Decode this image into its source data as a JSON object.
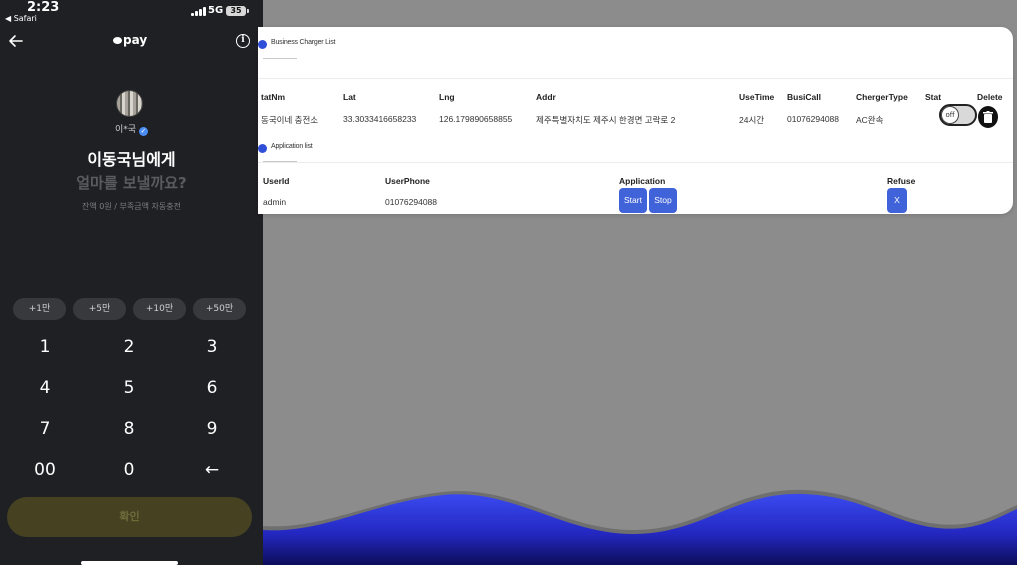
{
  "phone": {
    "status": {
      "time": "2:23",
      "back_app": "◀ Safari",
      "network": "5G",
      "battery": "35"
    },
    "header": {
      "logo_text": "pay"
    },
    "recipient": {
      "masked_name": "이*국",
      "to_line": "이동국님에게",
      "prompt": "얼마를 보낼까요?",
      "balance": "잔액 0원 / 부족금액 자동충전"
    },
    "quick_amounts": [
      "+1만",
      "+5만",
      "+10만",
      "+50만"
    ],
    "keypad": [
      "1",
      "2",
      "3",
      "4",
      "5",
      "6",
      "7",
      "8",
      "9",
      "00",
      "0",
      "←"
    ],
    "confirm_label": "확인"
  },
  "admin": {
    "charger_section": {
      "title": "Business Charger List",
      "columns": [
        "tatNm",
        "Lat",
        "Lng",
        "Addr",
        "UseTime",
        "BusiCall",
        "ChergerType",
        "Stat",
        "Delete"
      ],
      "rows": [
        {
          "statNm": "동국이네 충전소",
          "lat": "33.3033416658233",
          "lng": "126.179890658855",
          "addr": "제주특별자치도 제주시 한경면 고락로 2",
          "use_time": "24시간",
          "busi_call": "01076294088",
          "charger_type": "AC완속",
          "stat": "off"
        }
      ]
    },
    "application_section": {
      "title": "Application list",
      "columns": [
        "UserId",
        "UserPhone",
        "Application",
        "Refuse"
      ],
      "rows": [
        {
          "user_id": "admin",
          "user_phone": "01076294088",
          "start_label": "Start",
          "stop_label": "Stop",
          "refuse_label": "X"
        }
      ]
    }
  },
  "colors": {
    "phone_bg": "#1f2024",
    "accent_blue": "#4163d9",
    "wave_blue": "#2f35d8",
    "confirm_bg": "#464221"
  }
}
